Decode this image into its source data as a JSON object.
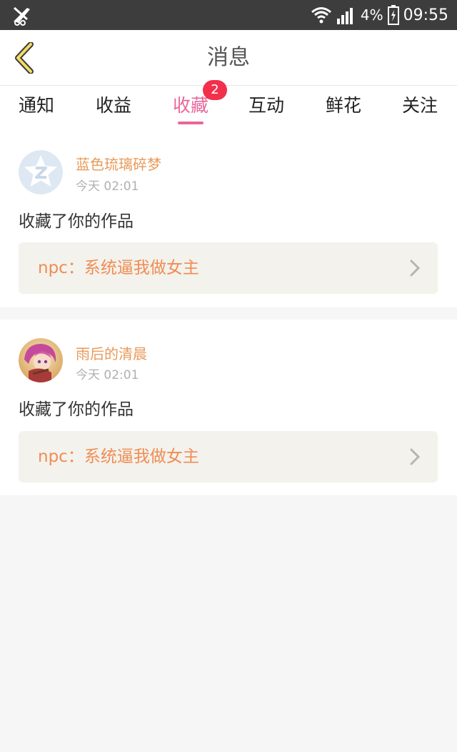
{
  "status_bar": {
    "battery_percent": "4%",
    "time": "09:55",
    "icons": [
      "app-notification-icon",
      "wifi-icon",
      "signal-icon",
      "battery-icon"
    ]
  },
  "header": {
    "title": "消息",
    "back_icon": "chevron-left-icon"
  },
  "tabs": [
    {
      "label": "通知"
    },
    {
      "label": "收益"
    },
    {
      "label": "收藏",
      "active": true,
      "badge": "2"
    },
    {
      "label": "互动"
    },
    {
      "label": "鲜花"
    },
    {
      "label": "关注"
    }
  ],
  "messages": [
    {
      "user": "蓝色琉璃碎梦",
      "time": "今天 02:01",
      "action": "收藏了你的作品",
      "work_title": "npc：系统逼我做女主",
      "avatar": "default-avatar-icon"
    },
    {
      "user": "雨后的清晨",
      "time": "今天 02:01",
      "action": "收藏了你的作品",
      "work_title": "npc：系统逼我做女主",
      "avatar": "anime-avatar"
    }
  ],
  "colors": {
    "accent": "#e8679a",
    "badge": "#f2304b",
    "username": "#e89a5a",
    "work_title": "#f08c54",
    "status_bar": "#3d3d3d"
  }
}
